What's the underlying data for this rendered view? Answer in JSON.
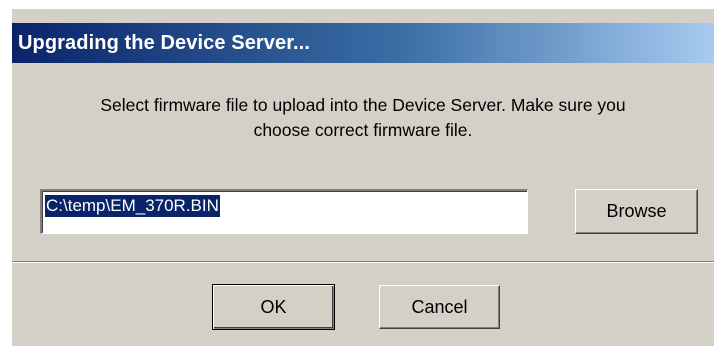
{
  "window": {
    "title": "Upgrading the Device Server..."
  },
  "message": {
    "line1": "Select firmware file to upload into the Device Server. Make sure you",
    "line2": "choose correct firmware file."
  },
  "file_field": {
    "value": "C:\\temp\\EM_370R.BIN"
  },
  "buttons": {
    "browse_label": "Browse",
    "ok_label": "OK",
    "cancel_label": "Cancel"
  },
  "colors": {
    "title_bar_start": "#0a246a",
    "title_bar_end": "#a6caf0",
    "dialog_face": "#d4d0c8",
    "selection": "#0a246a"
  }
}
